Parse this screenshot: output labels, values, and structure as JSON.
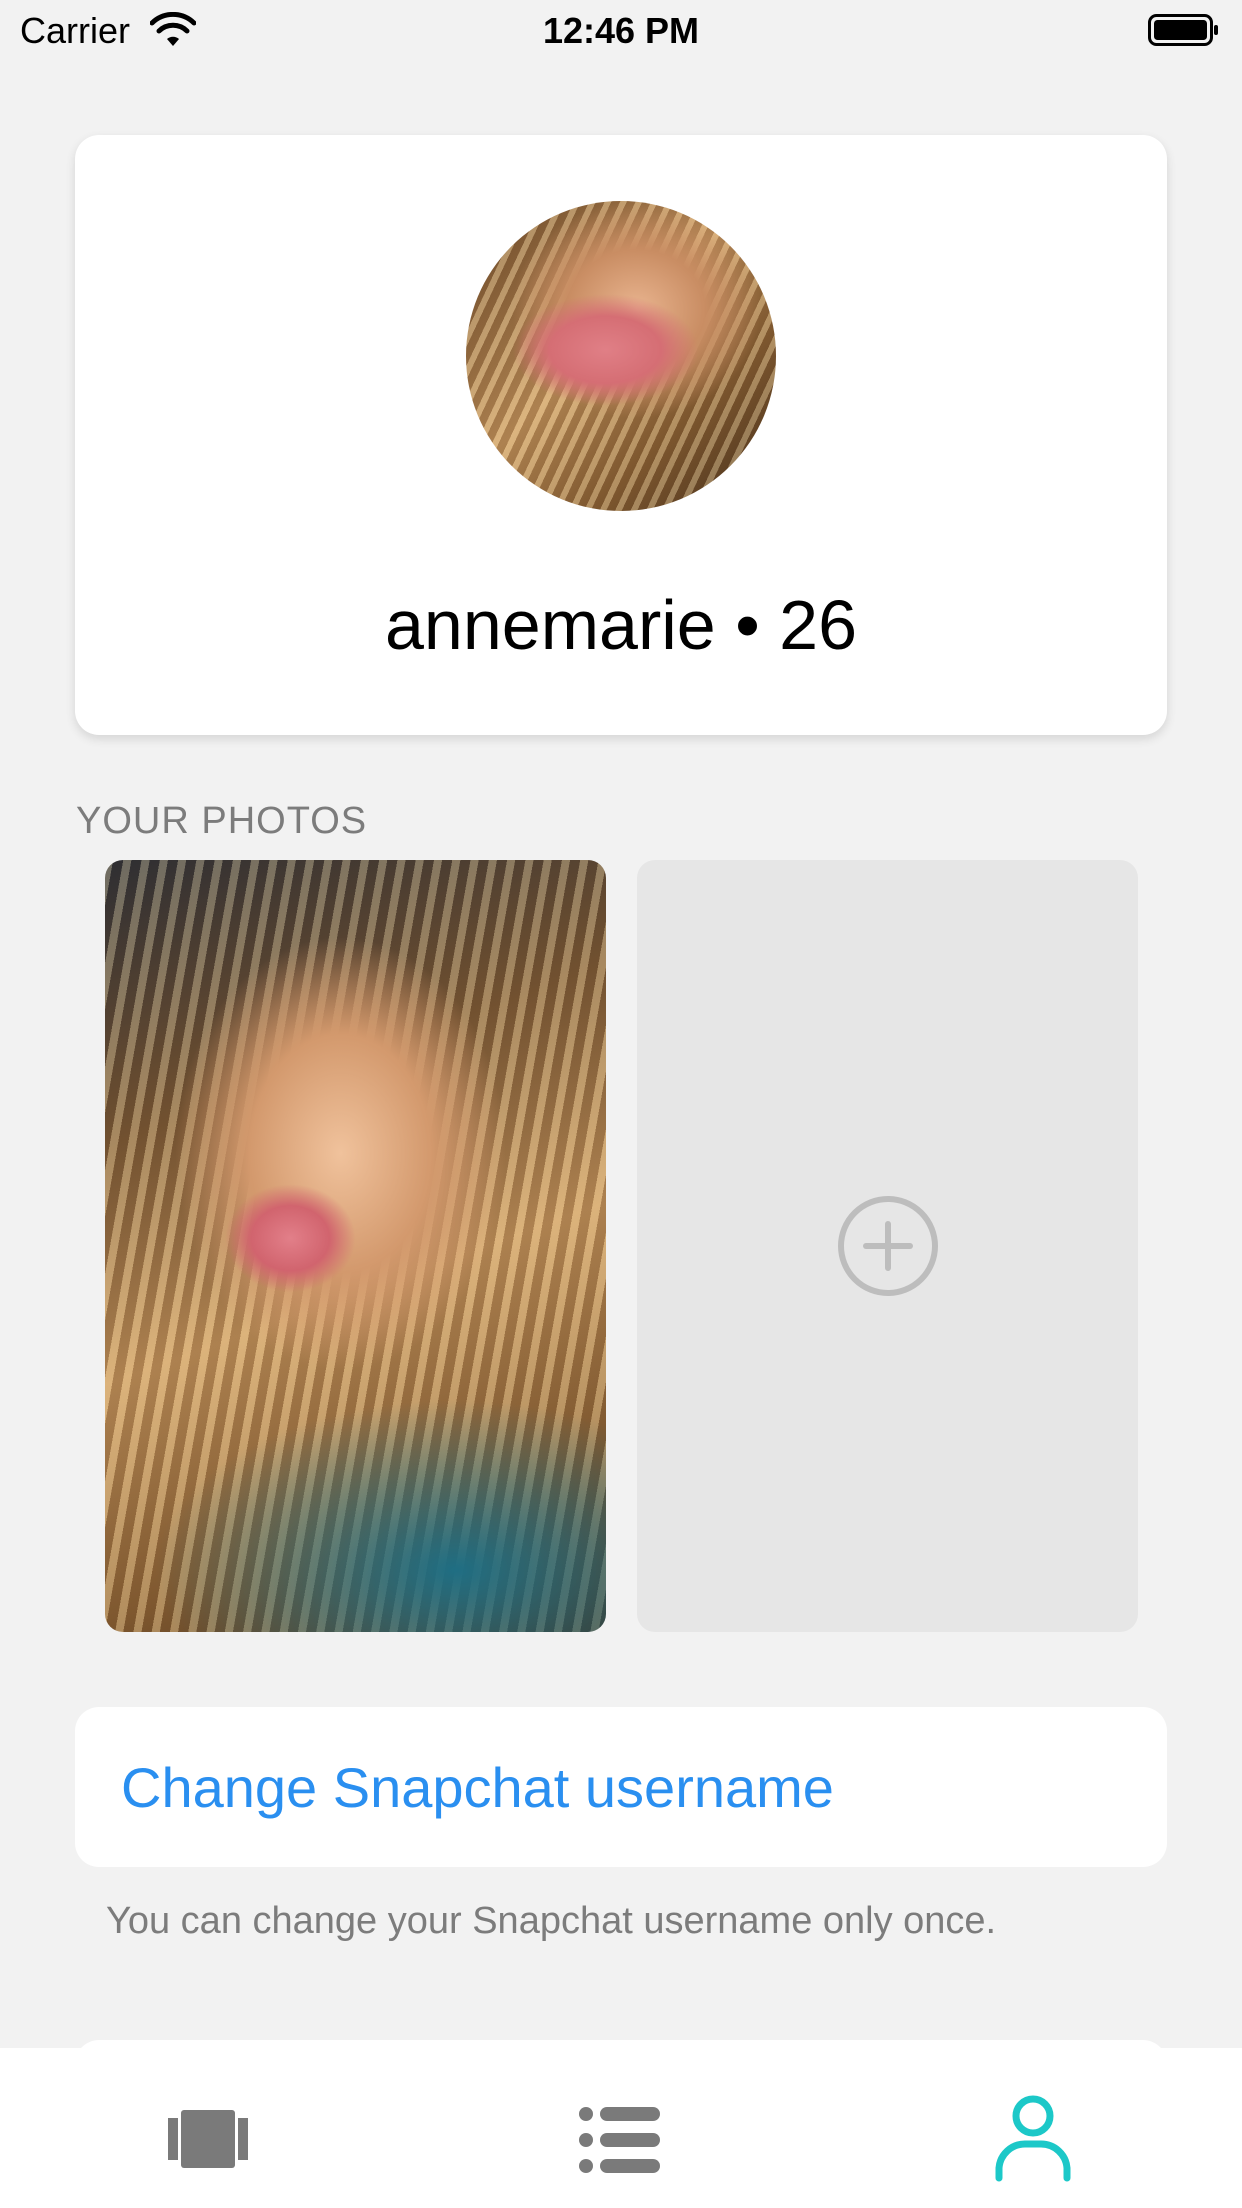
{
  "status_bar": {
    "carrier": "Carrier",
    "time": "12:46 PM"
  },
  "profile": {
    "name_age": "annemarie • 26",
    "avatar_icon": "avatar-photo"
  },
  "photos": {
    "header": "YOUR PHOTOS",
    "add_icon": "plus-circle-icon"
  },
  "snapchat": {
    "button_label": "Change Snapchat username",
    "note": "You can change your Snapchat username only once."
  },
  "tab_bar": {
    "items": [
      {
        "icon": "cards-icon",
        "active": false
      },
      {
        "icon": "list-icon",
        "active": false
      },
      {
        "icon": "profile-icon",
        "active": true
      }
    ]
  },
  "colors": {
    "accent": "#2a8ff0",
    "active_tab": "#1cc8c8",
    "inactive_tab": "#7a7a7a",
    "secondary_text": "#7c7c7c"
  }
}
